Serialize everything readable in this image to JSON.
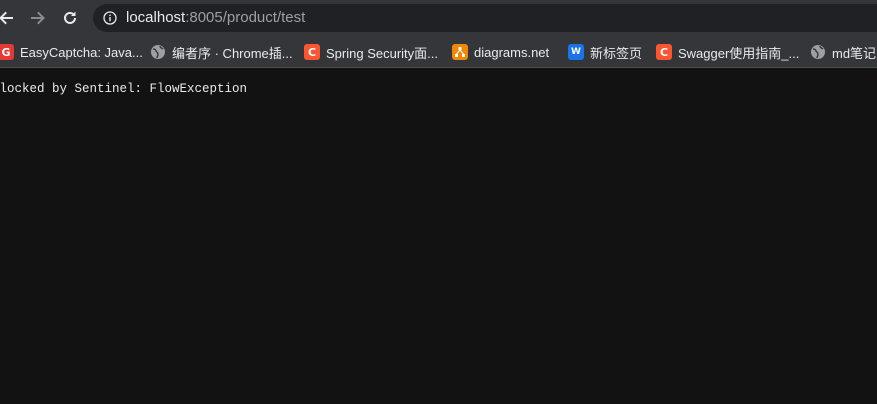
{
  "toolbar": {
    "url_host": "localhost",
    "url_rest": ":8005/product/test"
  },
  "bookmarks": [
    {
      "label": "EasyCaptcha: Java...",
      "icon": "easycaptcha-icon",
      "color": "#e53935"
    },
    {
      "label": "编者序 · Chrome插...",
      "icon": "globe-icon",
      "color": "#9aa0a6"
    },
    {
      "label": "Spring Security面...",
      "icon": "csdn-icon",
      "color": "#fc5531"
    },
    {
      "label": "diagrams.net",
      "icon": "diagrams-icon",
      "color": "#f08705"
    },
    {
      "label": "新标签页",
      "icon": "wetab-icon",
      "color": "#1a73e8"
    },
    {
      "label": "Swagger使用指南_...",
      "icon": "csdn-icon",
      "color": "#fc5531"
    },
    {
      "label": "md笔记",
      "icon": "globe-icon",
      "color": "#9aa0a6"
    }
  ],
  "page": {
    "message": "Blocked by Sentinel: FlowException"
  }
}
